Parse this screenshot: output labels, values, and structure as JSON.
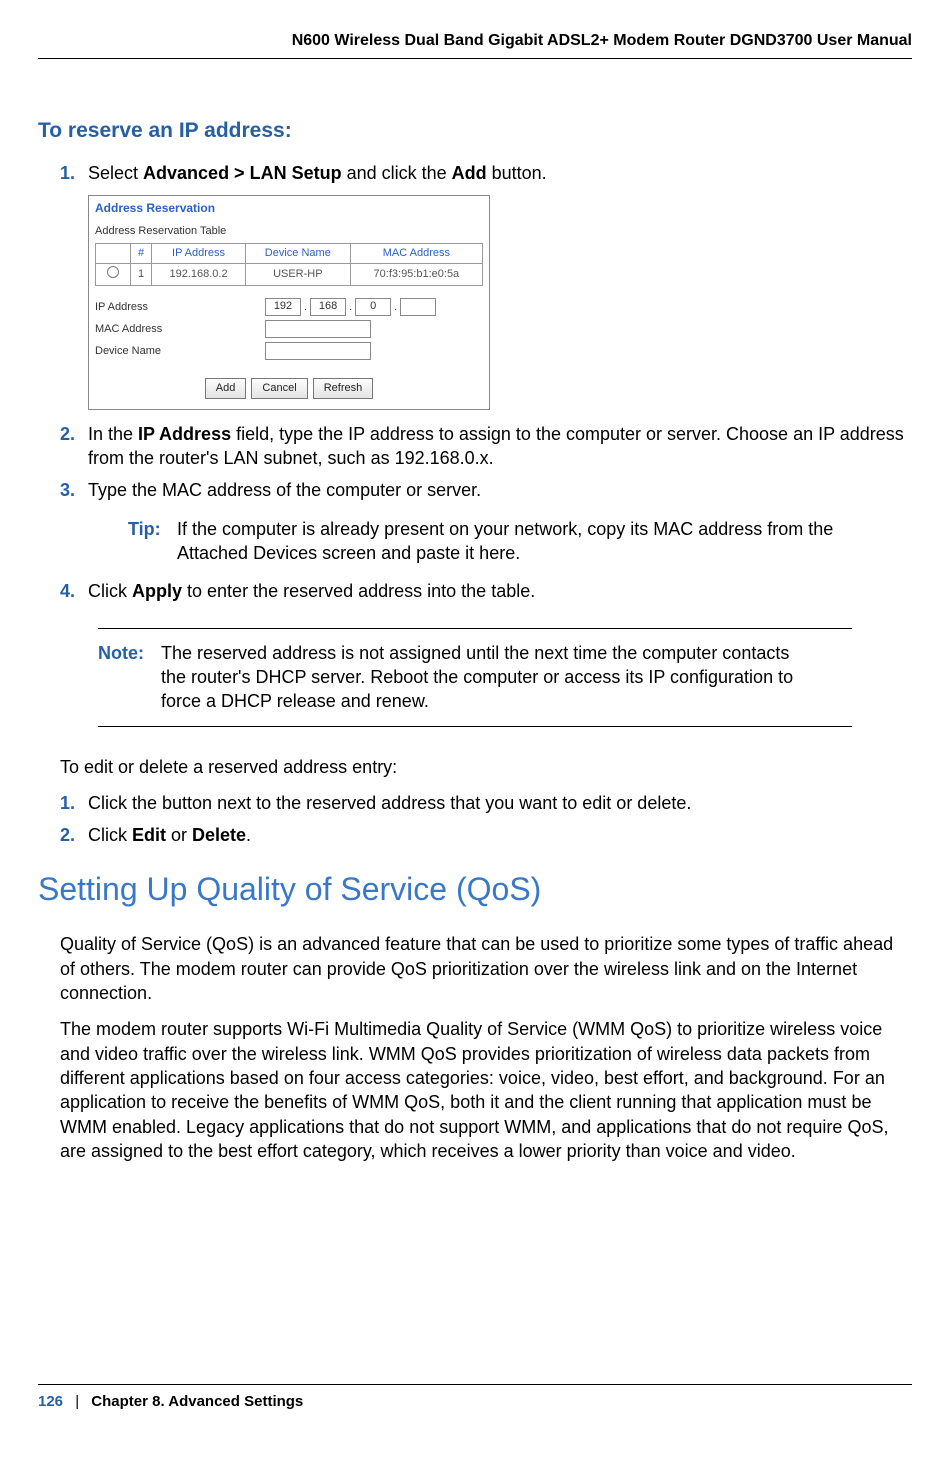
{
  "header": {
    "title": "N600 Wireless Dual Band Gigabit ADSL2+ Modem Router DGND3700 User Manual"
  },
  "sectionA": {
    "title": "To reserve an IP address:",
    "steps": {
      "s1_pre": "Select ",
      "s1_b1": "Advanced > LAN Setup",
      "s1_mid": " and click the ",
      "s1_b2": "Add",
      "s1_post": " button.",
      "s2_pre": "In the ",
      "s2_b": "IP Address",
      "s2_post": " field, type the IP address to assign to the computer or server. Choose an IP address from the router's LAN subnet, such as 192.168.0.x.",
      "s3": "Type the MAC address of the computer or server.",
      "s4_pre": "Click ",
      "s4_b": "Apply",
      "s4_post": " to enter the reserved address into the table."
    }
  },
  "screenshot": {
    "title": "Address Reservation",
    "subtitle": "Address Reservation Table",
    "cols": {
      "num": "#",
      "ip": "IP Address",
      "dev": "Device Name",
      "mac": "MAC Address"
    },
    "row": {
      "num": "1",
      "ip": "192.168.0.2",
      "dev": "USER-HP",
      "mac": "70:f3:95:b1:e0:5a"
    },
    "form": {
      "ip_label": "IP Address",
      "mac_label": "MAC Address",
      "dev_label": "Device Name",
      "oct1": "192",
      "oct2": "168",
      "oct3": "0",
      "oct4": ""
    },
    "buttons": {
      "add": "Add",
      "cancel": "Cancel",
      "refresh": "Refresh"
    }
  },
  "tip": {
    "label": "Tip:",
    "text": "If the computer is already present on your network, copy its MAC address from the Attached Devices screen and paste it here."
  },
  "note": {
    "label": "Note:",
    "text": "The reserved address is not assigned until the next time the computer contacts the router's DHCP server. Reboot the computer or access its IP configuration to force a DHCP release and renew."
  },
  "sectionB": {
    "intro": "To edit or delete a reserved address entry:",
    "s1": "Click the button next to the reserved address that you want to edit or delete.",
    "s2_pre": "Click ",
    "s2_b1": "Edit",
    "s2_mid": " or ",
    "s2_b2": "Delete",
    "s2_post": "."
  },
  "heading_qos": "Setting Up Quality of Service (QoS)",
  "qos_p1": "Quality of Service (QoS) is an advanced feature that can be used to prioritize some types of traffic ahead of others. The modem router can provide QoS prioritization over the wireless link and on the Internet connection.",
  "qos_p2": "The modem router supports Wi-Fi Multimedia Quality of Service (WMM QoS) to prioritize wireless voice and video traffic over the wireless link. WMM QoS provides prioritization of wireless data packets from different applications based on four access categories: voice, video, best effort, and background. For an application to receive the benefits of WMM QoS, both it and the client running that application must be WMM enabled. Legacy applications that do not support WMM, and applications that do not require QoS, are assigned to the best effort category, which receives a lower priority than voice and video.",
  "footer": {
    "page": "126",
    "sep": "|",
    "chapter": "Chapter 8.  Advanced Settings"
  }
}
